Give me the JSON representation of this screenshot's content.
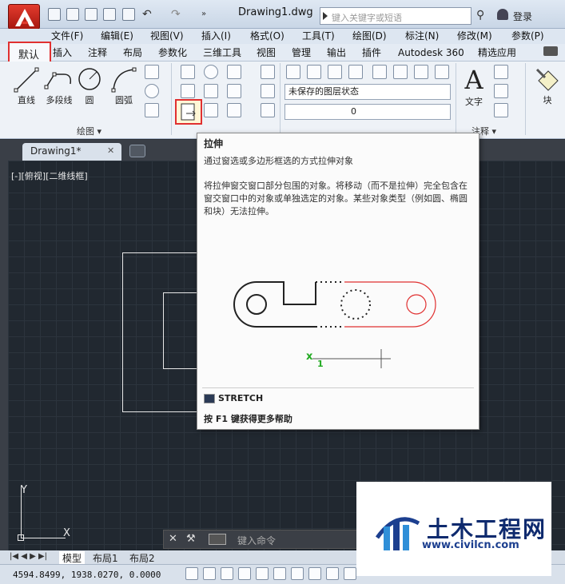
{
  "titlebar": {
    "doc_title": "Drawing1.dwg",
    "search_placeholder": "键入关键字或短语",
    "login_label": "登录"
  },
  "menubar": {
    "items": [
      "文件(F)",
      "编辑(E)",
      "视图(V)",
      "插入(I)",
      "格式(O)",
      "工具(T)",
      "绘图(D)",
      "标注(N)",
      "修改(M)",
      "参数(P)"
    ]
  },
  "ribbon_tabs": {
    "items": [
      "默认",
      "插入",
      "注释",
      "布局",
      "参数化",
      "三维工具",
      "视图",
      "管理",
      "输出",
      "插件",
      "Autodesk 360",
      "精选应用"
    ],
    "active": "默认"
  },
  "ribbon": {
    "draw_tools": [
      "直线",
      "多段线",
      "圆",
      "圆弧"
    ],
    "draw_panel_label": "绘图",
    "layer_state": "未保存的图层状态",
    "layer_current": "0",
    "text_tool": "文字",
    "annotation_panel_label": "注释",
    "block_tool": "块",
    "text_glyph": "A"
  },
  "doc_tabs": {
    "active_tab": "Drawing1*"
  },
  "viewport": {
    "label": "[-][俯视][二维线框]",
    "ucs_x": "X",
    "ucs_y": "Y"
  },
  "tooltip": {
    "title": "拉伸",
    "subtitle": "通过窗选或多边形框选的方式拉伸对象",
    "description": "将拉伸窗交窗口部分包围的对象。将移动（而不是拉伸）完全包含在窗交窗口中的对象或单独选定的对象。某些对象类型（例如圆、椭圆和块）无法拉伸。",
    "command": "STRETCH",
    "help": "按 F1 键获得更多帮助",
    "figure_x": "x",
    "figure_num": "1"
  },
  "cmdline": {
    "placeholder": "键入命令"
  },
  "layout_tabs": {
    "items": [
      "模型",
      "布局1",
      "布局2"
    ]
  },
  "statusbar": {
    "coords": "4594.8499, 1938.0270, 0.0000"
  },
  "watermark": {
    "title": "土木工程网",
    "url": "www.civilcn.com"
  },
  "colors": {
    "highlight_red": "#e03030",
    "canvas_bg": "#212830",
    "accent_green": "#22aa22"
  }
}
